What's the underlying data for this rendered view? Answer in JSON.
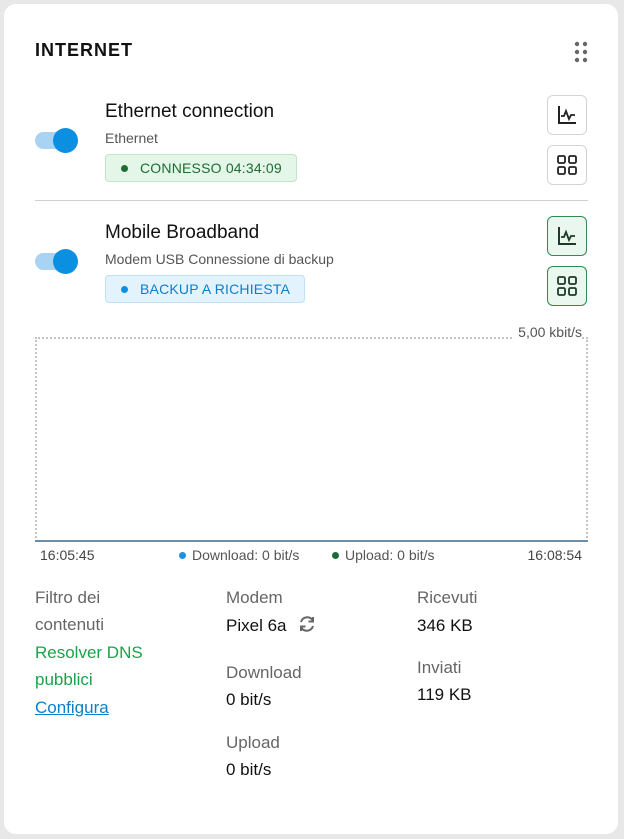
{
  "card": {
    "title": "INTERNET"
  },
  "connections": [
    {
      "name": "Ethernet connection",
      "subtitle": "Ethernet",
      "status": "CONNESSO 04:34:09",
      "status_color": "#1f6b34",
      "enabled": true
    },
    {
      "name": "Mobile Broadband",
      "subtitle": "Modem USB Connessione di backup",
      "status": "BACKUP A RICHIESTA",
      "status_color": "#0b8fe0",
      "enabled": true
    }
  ],
  "graph": {
    "max_label": "5,00 kbit/s",
    "time_start": "16:05:45",
    "time_end": "16:08:54",
    "legend": {
      "download": "Download: 0 bit/s",
      "download_color": "#1e90e0",
      "upload": "Upload: 0 bit/s",
      "upload_color": "#1f6b34"
    }
  },
  "stats": {
    "filter_label_line1": "Filtro dei",
    "filter_label_line2": "contenuti",
    "filter_value_line1": "Resolver DNS",
    "filter_value_line2": "pubblici",
    "configure_link": "Configura",
    "modem_label": "Modem",
    "modem_value": "Pixel 6a",
    "download_label": "Download",
    "download_value": "0 bit/s",
    "upload_label": "Upload",
    "upload_value": "0 bit/s",
    "received_label": "Ricevuti",
    "received_value": "346 KB",
    "sent_label": "Inviati",
    "sent_value": "119 KB"
  },
  "icons": [
    "more-vertical-icon",
    "chart-icon",
    "grid-icon",
    "refresh-icon"
  ]
}
